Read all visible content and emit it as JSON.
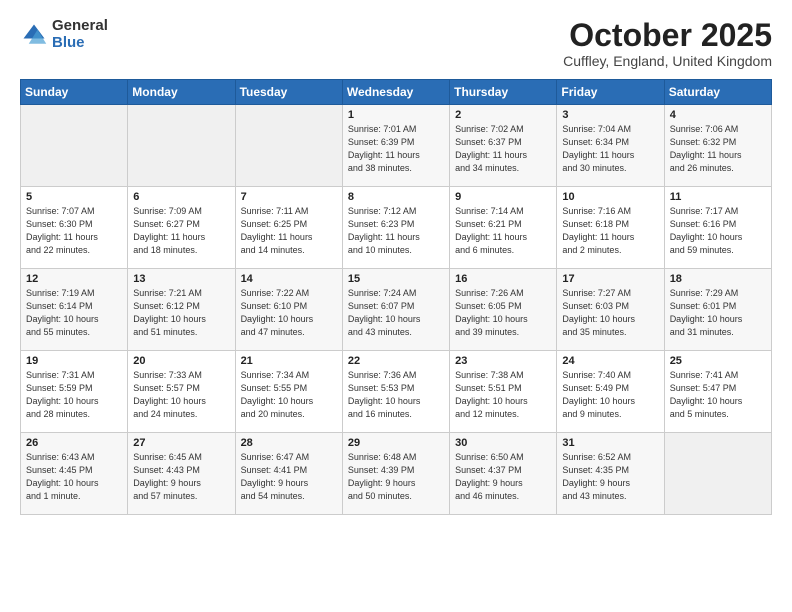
{
  "header": {
    "logo_general": "General",
    "logo_blue": "Blue",
    "month_title": "October 2025",
    "location": "Cuffley, England, United Kingdom"
  },
  "weekdays": [
    "Sunday",
    "Monday",
    "Tuesday",
    "Wednesday",
    "Thursday",
    "Friday",
    "Saturday"
  ],
  "weeks": [
    [
      {
        "day": "",
        "info": ""
      },
      {
        "day": "",
        "info": ""
      },
      {
        "day": "",
        "info": ""
      },
      {
        "day": "1",
        "info": "Sunrise: 7:01 AM\nSunset: 6:39 PM\nDaylight: 11 hours\nand 38 minutes."
      },
      {
        "day": "2",
        "info": "Sunrise: 7:02 AM\nSunset: 6:37 PM\nDaylight: 11 hours\nand 34 minutes."
      },
      {
        "day": "3",
        "info": "Sunrise: 7:04 AM\nSunset: 6:34 PM\nDaylight: 11 hours\nand 30 minutes."
      },
      {
        "day": "4",
        "info": "Sunrise: 7:06 AM\nSunset: 6:32 PM\nDaylight: 11 hours\nand 26 minutes."
      }
    ],
    [
      {
        "day": "5",
        "info": "Sunrise: 7:07 AM\nSunset: 6:30 PM\nDaylight: 11 hours\nand 22 minutes."
      },
      {
        "day": "6",
        "info": "Sunrise: 7:09 AM\nSunset: 6:27 PM\nDaylight: 11 hours\nand 18 minutes."
      },
      {
        "day": "7",
        "info": "Sunrise: 7:11 AM\nSunset: 6:25 PM\nDaylight: 11 hours\nand 14 minutes."
      },
      {
        "day": "8",
        "info": "Sunrise: 7:12 AM\nSunset: 6:23 PM\nDaylight: 11 hours\nand 10 minutes."
      },
      {
        "day": "9",
        "info": "Sunrise: 7:14 AM\nSunset: 6:21 PM\nDaylight: 11 hours\nand 6 minutes."
      },
      {
        "day": "10",
        "info": "Sunrise: 7:16 AM\nSunset: 6:18 PM\nDaylight: 11 hours\nand 2 minutes."
      },
      {
        "day": "11",
        "info": "Sunrise: 7:17 AM\nSunset: 6:16 PM\nDaylight: 10 hours\nand 59 minutes."
      }
    ],
    [
      {
        "day": "12",
        "info": "Sunrise: 7:19 AM\nSunset: 6:14 PM\nDaylight: 10 hours\nand 55 minutes."
      },
      {
        "day": "13",
        "info": "Sunrise: 7:21 AM\nSunset: 6:12 PM\nDaylight: 10 hours\nand 51 minutes."
      },
      {
        "day": "14",
        "info": "Sunrise: 7:22 AM\nSunset: 6:10 PM\nDaylight: 10 hours\nand 47 minutes."
      },
      {
        "day": "15",
        "info": "Sunrise: 7:24 AM\nSunset: 6:07 PM\nDaylight: 10 hours\nand 43 minutes."
      },
      {
        "day": "16",
        "info": "Sunrise: 7:26 AM\nSunset: 6:05 PM\nDaylight: 10 hours\nand 39 minutes."
      },
      {
        "day": "17",
        "info": "Sunrise: 7:27 AM\nSunset: 6:03 PM\nDaylight: 10 hours\nand 35 minutes."
      },
      {
        "day": "18",
        "info": "Sunrise: 7:29 AM\nSunset: 6:01 PM\nDaylight: 10 hours\nand 31 minutes."
      }
    ],
    [
      {
        "day": "19",
        "info": "Sunrise: 7:31 AM\nSunset: 5:59 PM\nDaylight: 10 hours\nand 28 minutes."
      },
      {
        "day": "20",
        "info": "Sunrise: 7:33 AM\nSunset: 5:57 PM\nDaylight: 10 hours\nand 24 minutes."
      },
      {
        "day": "21",
        "info": "Sunrise: 7:34 AM\nSunset: 5:55 PM\nDaylight: 10 hours\nand 20 minutes."
      },
      {
        "day": "22",
        "info": "Sunrise: 7:36 AM\nSunset: 5:53 PM\nDaylight: 10 hours\nand 16 minutes."
      },
      {
        "day": "23",
        "info": "Sunrise: 7:38 AM\nSunset: 5:51 PM\nDaylight: 10 hours\nand 12 minutes."
      },
      {
        "day": "24",
        "info": "Sunrise: 7:40 AM\nSunset: 5:49 PM\nDaylight: 10 hours\nand 9 minutes."
      },
      {
        "day": "25",
        "info": "Sunrise: 7:41 AM\nSunset: 5:47 PM\nDaylight: 10 hours\nand 5 minutes."
      }
    ],
    [
      {
        "day": "26",
        "info": "Sunrise: 6:43 AM\nSunset: 4:45 PM\nDaylight: 10 hours\nand 1 minute."
      },
      {
        "day": "27",
        "info": "Sunrise: 6:45 AM\nSunset: 4:43 PM\nDaylight: 9 hours\nand 57 minutes."
      },
      {
        "day": "28",
        "info": "Sunrise: 6:47 AM\nSunset: 4:41 PM\nDaylight: 9 hours\nand 54 minutes."
      },
      {
        "day": "29",
        "info": "Sunrise: 6:48 AM\nSunset: 4:39 PM\nDaylight: 9 hours\nand 50 minutes."
      },
      {
        "day": "30",
        "info": "Sunrise: 6:50 AM\nSunset: 4:37 PM\nDaylight: 9 hours\nand 46 minutes."
      },
      {
        "day": "31",
        "info": "Sunrise: 6:52 AM\nSunset: 4:35 PM\nDaylight: 9 hours\nand 43 minutes."
      },
      {
        "day": "",
        "info": ""
      }
    ]
  ]
}
